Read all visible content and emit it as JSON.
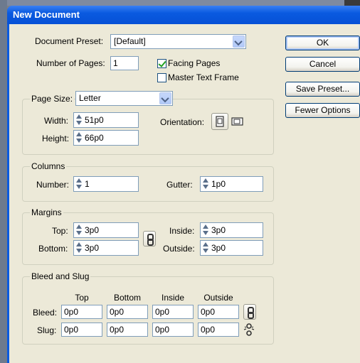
{
  "window": {
    "title": "New Document"
  },
  "document_preset": {
    "label": "Document Preset:",
    "value": "[Default]"
  },
  "number_of_pages": {
    "label": "Number of Pages:",
    "value": "1"
  },
  "facing_pages": {
    "label": "Facing Pages",
    "checked": true
  },
  "master_text_frame": {
    "label": "Master Text Frame",
    "checked": false
  },
  "buttons": {
    "ok": "OK",
    "cancel": "Cancel",
    "save_preset": "Save Preset...",
    "fewer_options": "Fewer Options"
  },
  "page_size": {
    "label": "Page Size:",
    "value": "Letter",
    "width_label": "Width:",
    "width": "51p0",
    "height_label": "Height:",
    "height": "66p0",
    "orientation_label": "Orientation:"
  },
  "columns": {
    "title": "Columns",
    "number_label": "Number:",
    "number": "1",
    "gutter_label": "Gutter:",
    "gutter": "1p0"
  },
  "margins": {
    "title": "Margins",
    "top_label": "Top:",
    "top": "3p0",
    "bottom_label": "Bottom:",
    "bottom": "3p0",
    "inside_label": "Inside:",
    "inside": "3p0",
    "outside_label": "Outside:",
    "outside": "3p0"
  },
  "bleed_slug": {
    "title": "Bleed and Slug",
    "headers": [
      "Top",
      "Bottom",
      "Inside",
      "Outside"
    ],
    "bleed_label": "Bleed:",
    "bleed": [
      "0p0",
      "0p0",
      "0p0",
      "0p0"
    ],
    "slug_label": "Slug:",
    "slug": [
      "0p0",
      "0p0",
      "0p0",
      "0p0"
    ]
  },
  "colors": {
    "titlebar": "#0a5ae0",
    "dialog_bg": "#ece9d8",
    "field_border": "#7f9db9"
  },
  "icons": [
    "portrait-orientation-icon",
    "landscape-orientation-icon",
    "chain-link-icon",
    "broken-chain-icon"
  ]
}
